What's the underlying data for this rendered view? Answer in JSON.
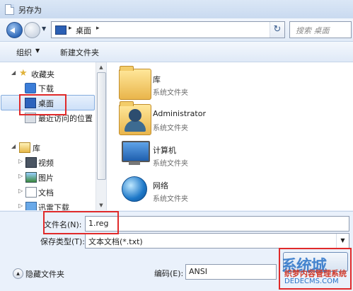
{
  "window": {
    "title": "另存为"
  },
  "nav": {
    "address_path": "桌面",
    "search_placeholder": "搜索 桌面"
  },
  "toolbar": {
    "organize_label": "组织",
    "new_folder_label": "新建文件夹"
  },
  "sidebar": {
    "items": [
      {
        "label": "收藏夹",
        "icon": "star-icon"
      },
      {
        "label": "下载",
        "icon": "download-folder-icon"
      },
      {
        "label": "桌面",
        "icon": "desktop-icon",
        "selected": true
      },
      {
        "label": "最近访问的位置",
        "icon": "recent-places-icon"
      },
      {
        "label": "库",
        "icon": "library-icon"
      },
      {
        "label": "视频",
        "icon": "video-library-icon"
      },
      {
        "label": "图片",
        "icon": "pictures-library-icon"
      },
      {
        "label": "文档",
        "icon": "documents-library-icon"
      },
      {
        "label": "迅雷下载",
        "icon": "thunder-download-icon"
      }
    ]
  },
  "files": [
    {
      "name": "库",
      "type": "系统文件夹",
      "icon": "library-folder-icon"
    },
    {
      "name": "Administrator",
      "type": "系统文件夹",
      "icon": "user-folder-icon"
    },
    {
      "name": "计算机",
      "type": "系统文件夹",
      "icon": "computer-icon"
    },
    {
      "name": "网络",
      "type": "系统文件夹",
      "icon": "network-icon"
    }
  ],
  "form": {
    "filename_label": "文件名(N):",
    "filename_value": "1.reg",
    "savetype_label": "保存类型(T):",
    "savetype_value": "文本文档(*.txt)",
    "hide_folders_label": "隐藏文件夹",
    "encoding_label": "编码(E):",
    "encoding_value": "ANSI"
  },
  "watermark": {
    "logo": "系统城",
    "line1": "织梦内容管理系统",
    "url": "DEDECMS.COM"
  },
  "colors": {
    "highlight": "#e02a2a",
    "window_bg": "#eaf1fb",
    "selection": "#cde0f8"
  }
}
